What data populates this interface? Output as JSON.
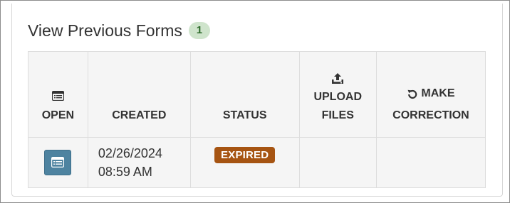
{
  "section": {
    "title": "View Previous Forms",
    "count": "1"
  },
  "table": {
    "headers": {
      "open": "OPEN",
      "created": "CREATED",
      "status": "STATUS",
      "upload_line1": "UPLOAD",
      "upload_line2": "FILES",
      "correction_line1": "MAKE",
      "correction_line2": "CORRECTION"
    },
    "header_icons": {
      "open": "form-list-icon",
      "upload": "upload-icon",
      "correction": "undo-icon"
    },
    "rows": [
      {
        "open_icon": "form-list-icon",
        "created_date": "02/26/2024",
        "created_time": "08:59 AM",
        "status": "EXPIRED",
        "upload_files": "",
        "make_correction": ""
      }
    ]
  },
  "colors": {
    "open_button": "#4e83a0",
    "status_expired": "#a65412",
    "count_badge_bg": "#cfe4cc",
    "count_badge_text": "#2f6b2c",
    "table_bg": "#f5f5f5"
  }
}
